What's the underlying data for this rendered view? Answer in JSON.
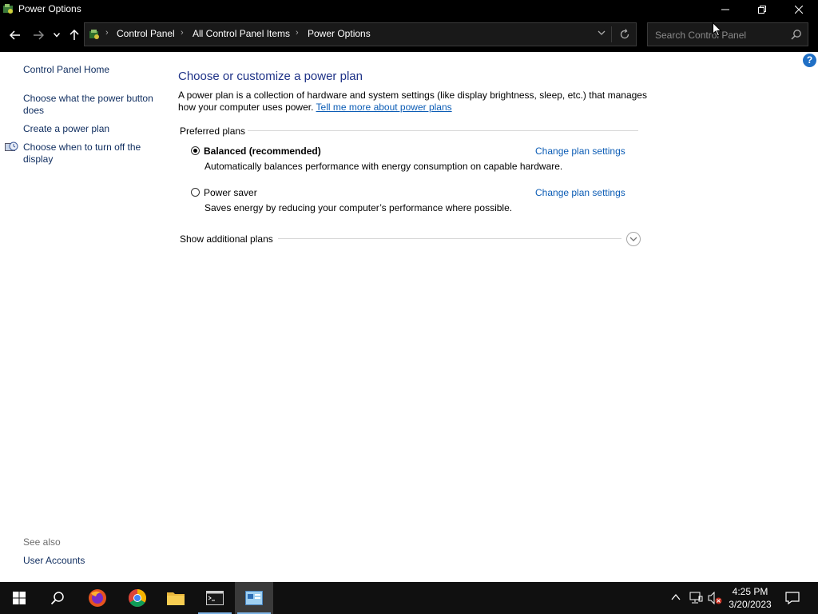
{
  "window": {
    "title": "Power Options"
  },
  "navigation": {
    "breadcrumbs": [
      "Control Panel",
      "All Control Panel Items",
      "Power Options"
    ],
    "search_placeholder": "Search Control Panel"
  },
  "sidebar": {
    "home": "Control Panel Home",
    "links": [
      "Choose what the power button does",
      "Create a power plan",
      "Choose when to turn off the display"
    ],
    "see_also_label": "See also",
    "see_also_links": [
      "User Accounts"
    ]
  },
  "main": {
    "heading": "Choose or customize a power plan",
    "description": "A power plan is a collection of hardware and system settings (like display brightness, sleep, etc.) that manages how your computer uses power.",
    "learn_more": "Tell me more about power plans",
    "preferred_label": "Preferred plans",
    "plans": [
      {
        "name": "Balanced (recommended)",
        "description": "Automatically balances performance with energy consumption on capable hardware.",
        "change_label": "Change plan settings",
        "selected": true
      },
      {
        "name": "Power saver",
        "description": "Saves energy by reducing your computer’s performance where possible.",
        "change_label": "Change plan settings",
        "selected": false
      }
    ],
    "show_additional": "Show additional plans"
  },
  "taskbar": {
    "apps": [
      "start",
      "search",
      "firefox",
      "chrome",
      "file-explorer",
      "terminal",
      "control-panel"
    ],
    "time": "4:25 PM",
    "date": "3/20/2023"
  },
  "colors": {
    "titlebar_bg": "#000000",
    "heading": "#1e3287",
    "link": "#0b5cb5",
    "taskbar_bg": "#101010"
  }
}
